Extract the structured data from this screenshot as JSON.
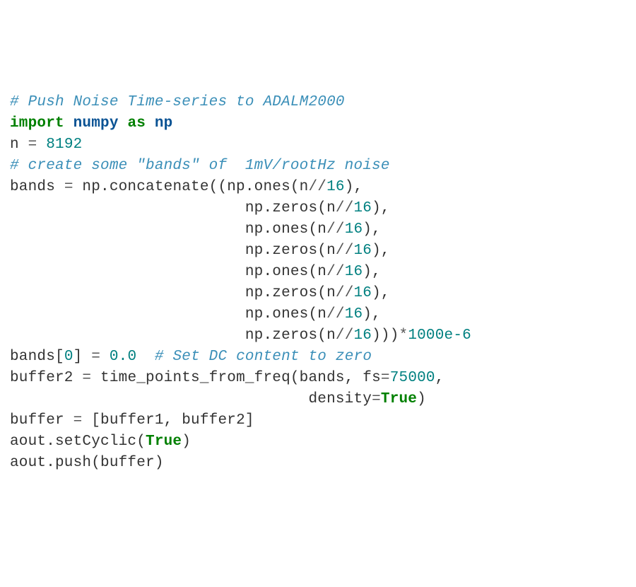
{
  "tokens": {
    "t00": "# Push Noise Time-series to ADALM2000",
    "t01": "import",
    "t02": "numpy",
    "t03": "as",
    "t04": "np",
    "t05": "n ",
    "t06": "=",
    "t07": " ",
    "t08": "8192",
    "t09": "# create some \"bands\" of  1mV/rootHz noise",
    "t10": "bands ",
    "t11": "=",
    "t12": " np.concatenate((np.ones(n",
    "t13": "//",
    "t14": "16",
    "t15": "),",
    "indent1": "                          ",
    "t16": "np.zeros(n",
    "t17": "np.ones(n",
    "t18": ")))",
    "t19": "*",
    "t20": "1000e-6",
    "t21": "bands[",
    "t22": "0",
    "t23": "] ",
    "t24": "=",
    "t25": " ",
    "t26": "0.0",
    "t27": "  ",
    "t28": "# Set DC content to zero",
    "t29": "buffer2 ",
    "t30": "=",
    "t31": " time_points_from_freq(bands, fs",
    "t32": "=",
    "t33": "75000",
    "t34": ",",
    "indent2": "                                 ",
    "t35": "density",
    "t36": "=",
    "t37": "True",
    "t38": ")",
    "t39": "buffer ",
    "t40": "=",
    "t41": " [buffer1, buffer2]",
    "t42": "aout.setCyclic(",
    "t43": "True",
    "t44": ")",
    "t45": "aout.push(buffer)"
  }
}
